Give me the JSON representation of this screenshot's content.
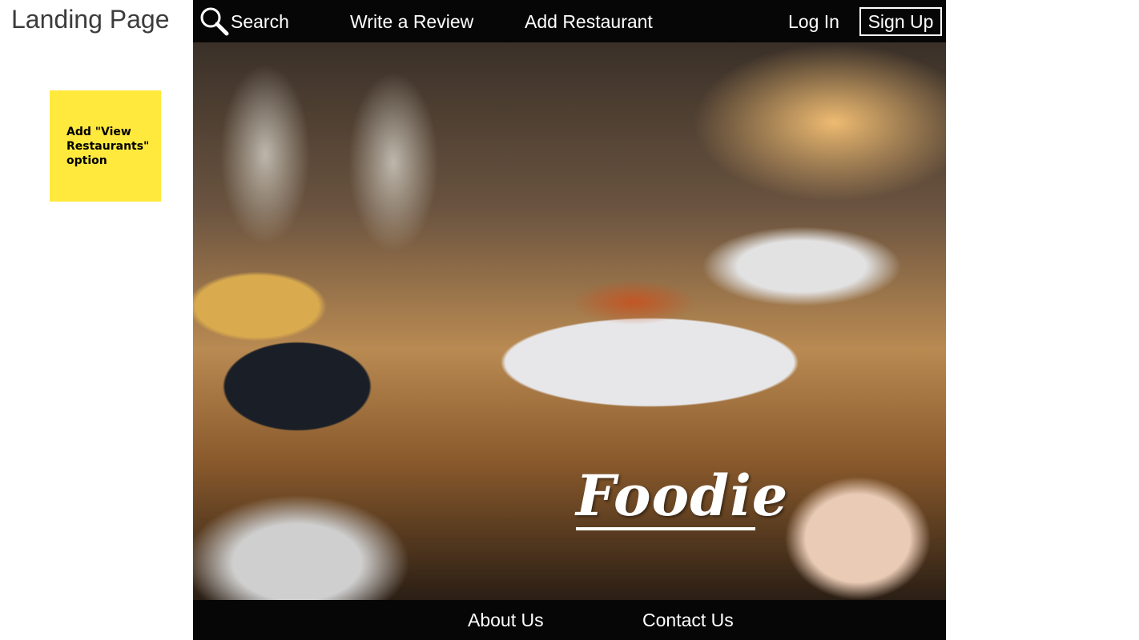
{
  "slide_title": "Landing Page",
  "sticky_note": {
    "text": "Add \"View Restaurants\" option",
    "color": "#ffe93d"
  },
  "nav": {
    "search": "Search",
    "write_review": "Write a Review",
    "add_restaurant": "Add Restaurant",
    "login": "Log In",
    "signup": "Sign Up"
  },
  "hero": {
    "logo": "Foodie"
  },
  "footer": {
    "about": "About Us",
    "contact": "Contact Us"
  },
  "colors": {
    "bar_background": "#060606",
    "text": "#ffffff"
  }
}
